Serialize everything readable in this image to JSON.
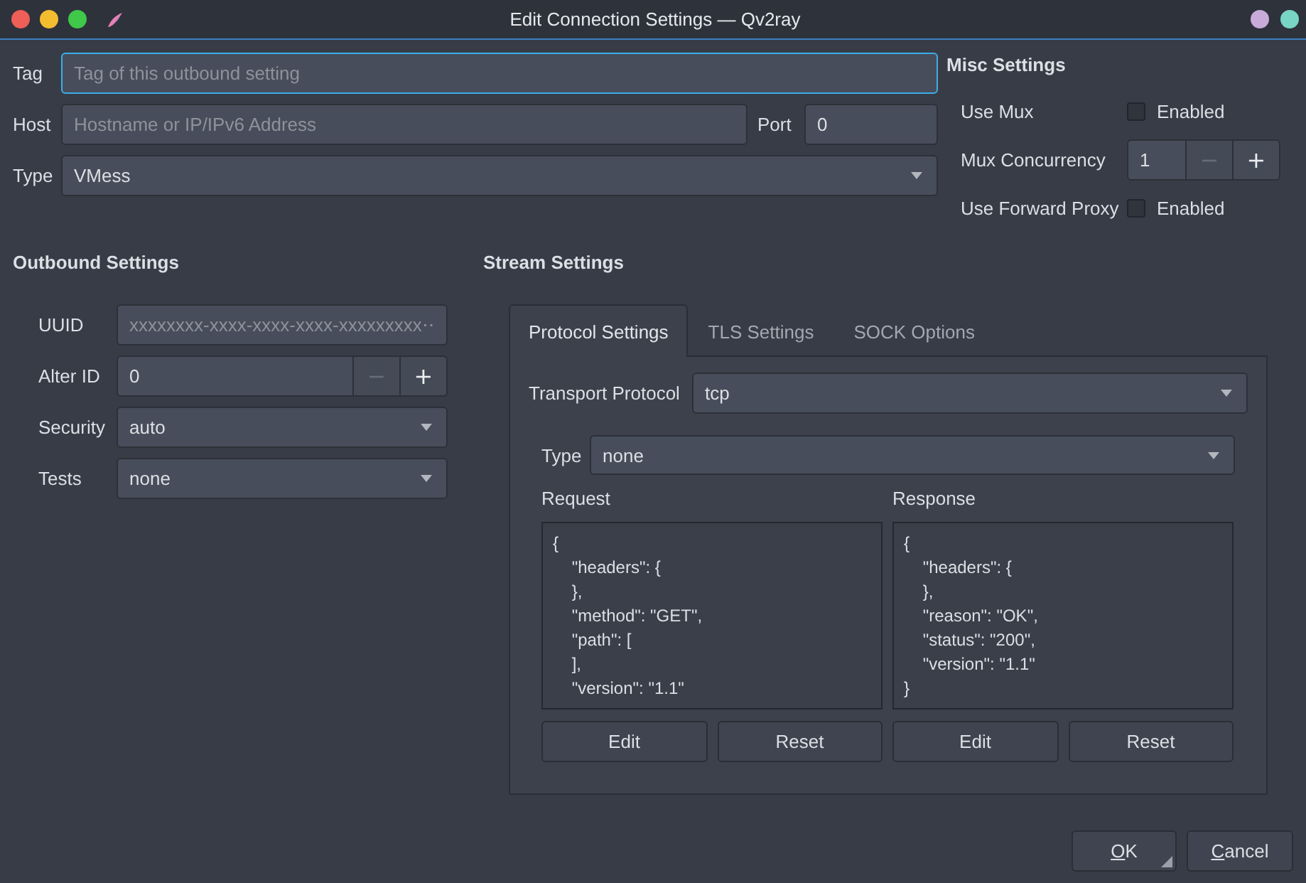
{
  "window": {
    "title": "Edit Connection Settings — Qv2ray",
    "buttons_left": [
      {
        "color": "#ed5f57"
      },
      {
        "color": "#f4bd30"
      },
      {
        "color": "#3fc84a"
      }
    ],
    "buttons_right": [
      {
        "color": "#c9abd9"
      },
      {
        "color": "#78d5c6"
      }
    ]
  },
  "connection": {
    "tag": {
      "label": "Tag",
      "placeholder": "Tag of this outbound setting",
      "focused": true
    },
    "host": {
      "label": "Host",
      "placeholder": "Hostname or IP/IPv6 Address"
    },
    "port": {
      "label": "Port",
      "value": "0"
    },
    "type": {
      "label": "Type",
      "value": "VMess"
    }
  },
  "misc_settings": {
    "title": "Misc Settings",
    "rows": [
      {
        "kind": "checkbox",
        "label": "Use Mux",
        "text": "Enabled",
        "checked": false
      },
      {
        "kind": "spinbox",
        "label": "Mux Concurrency",
        "value": "1",
        "steppers": [
          {
            "symbol": "−",
            "disabled": true
          },
          {
            "symbol": "+",
            "disabled": false
          }
        ]
      },
      {
        "kind": "checkbox",
        "label": "Use Forward Proxy",
        "text": "Enabled",
        "checked": false
      }
    ]
  },
  "outbound_settings": {
    "title": "Outbound Settings",
    "rows": [
      {
        "kind": "text",
        "label": "UUID",
        "placeholder": "xxxxxxxx-xxxx-xxxx-xxxx-xxxxxxxxx⋯"
      },
      {
        "kind": "spinbox",
        "label": "Alter ID",
        "value": "0",
        "steppers": [
          {
            "symbol": "−",
            "disabled": true
          },
          {
            "symbol": "+",
            "disabled": false
          }
        ]
      },
      {
        "kind": "combo",
        "label": "Security",
        "value": "auto"
      },
      {
        "kind": "combo",
        "label": "Tests",
        "value": "none"
      }
    ]
  },
  "stream_settings": {
    "title": "Stream Settings",
    "tabs": [
      {
        "label": "Protocol Settings",
        "selected": true
      },
      {
        "label": "TLS Settings",
        "selected": false
      },
      {
        "label": "SOCK Options",
        "selected": false
      }
    ],
    "transport_protocol": {
      "label": "Transport Protocol",
      "value": "tcp"
    },
    "header_type": {
      "label": "Type",
      "value": "none"
    },
    "editors": [
      {
        "label": "Request",
        "text": "{\n    \"headers\": {\n    },\n    \"method\": \"GET\",\n    \"path\": [\n    ],\n    \"version\": \"1.1\"",
        "buttons": [
          "Edit",
          "Reset"
        ]
      },
      {
        "label": "Response",
        "text": "{\n    \"headers\": {\n    },\n    \"reason\": \"OK\",\n    \"status\": \"200\",\n    \"version\": \"1.1\"\n}",
        "buttons": [
          "Edit",
          "Reset"
        ]
      }
    ]
  },
  "dialog_buttons": [
    {
      "label": "OK",
      "mnemonic": true,
      "default": true
    },
    {
      "label": "Cancel",
      "mnemonic": true,
      "default": false
    }
  ]
}
